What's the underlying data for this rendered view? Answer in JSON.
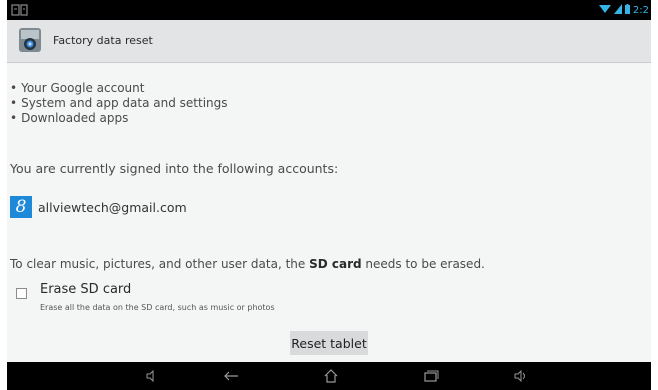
{
  "status_bar": {
    "left_icon": "notification-icon",
    "time": "2:2"
  },
  "action_bar": {
    "icon": "settings-app-icon",
    "title": "Factory data reset"
  },
  "content": {
    "bullets": [
      "Your Google account",
      "System and app data and settings",
      "Downloaded apps"
    ],
    "signed_in_text": "You are currently signed into the following accounts:",
    "account": {
      "icon": "google-account-icon",
      "icon_letter": "8",
      "email": "allviewtech@gmail.com"
    },
    "clear_text_prefix": "To clear music, pictures, and other user data, the ",
    "clear_text_bold": "SD card",
    "clear_text_suffix": " needs to be erased.",
    "erase_sd": {
      "label": "Erase SD card",
      "description": "Erase all the data on the SD card, such as music or photos",
      "checked": false
    },
    "reset_button_label": "Reset tablet"
  },
  "nav_bar": {
    "buttons": [
      "volume-down-icon",
      "back-icon",
      "home-icon",
      "recent-apps-icon",
      "volume-up-icon"
    ]
  },
  "colors": {
    "accent": "#33b5e5",
    "google_blue": "#1e88d9",
    "background": "#f4f5f5"
  }
}
